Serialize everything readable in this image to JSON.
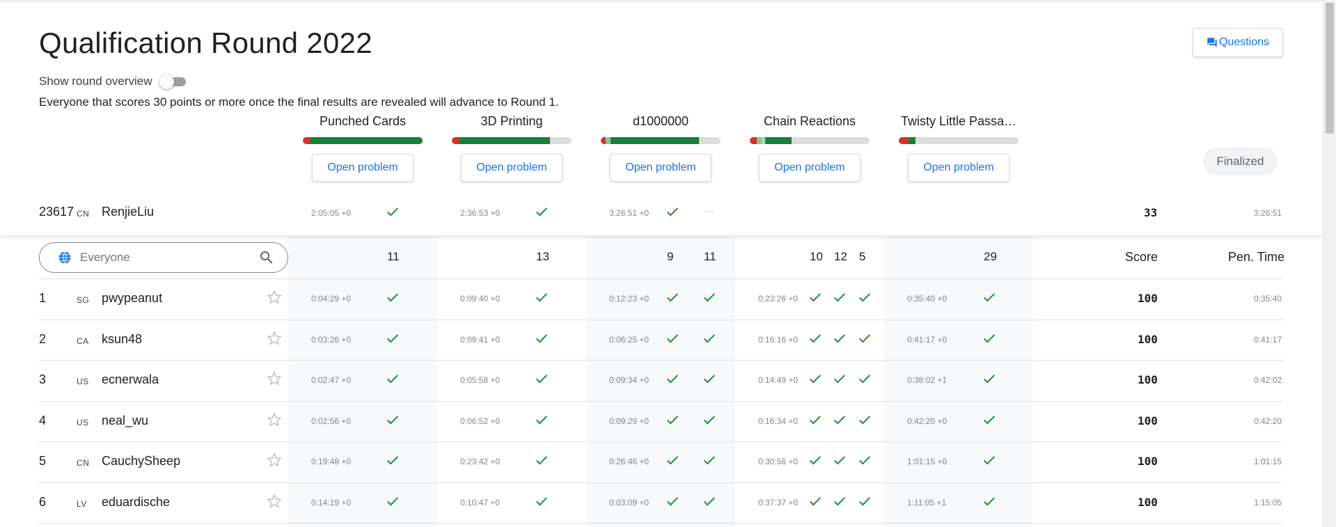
{
  "page": {
    "title": "Qualification Round 2022",
    "questions_label": "Questions",
    "overview_label": "Show round overview",
    "notice": "Everyone that scores 30 points or more once the final results are revealed will advance to Round 1.",
    "finalized_label": "Finalized",
    "open_problem_label": "Open problem"
  },
  "colors": {
    "accent": "#1a73e8",
    "check_green": "#1e8e3e",
    "bar_dark_green": "#188038",
    "bar_light_green": "#81c995",
    "bar_red": "#d93025",
    "bar_empty": "#dadce0"
  },
  "problems": [
    {
      "name": "Punched Cards",
      "fractions": [
        {
          "color": "#d93025",
          "pct": 6
        },
        {
          "color": "#188038",
          "pct": 94
        }
      ]
    },
    {
      "name": "3D Printing",
      "fractions": [
        {
          "color": "#d93025",
          "pct": 6
        },
        {
          "color": "#188038",
          "pct": 76
        }
      ]
    },
    {
      "name": "d1000000",
      "fractions": [
        {
          "color": "#d93025",
          "pct": 4
        },
        {
          "color": "#81c995",
          "pct": 4
        },
        {
          "color": "#188038",
          "pct": 74
        }
      ]
    },
    {
      "name": "Chain Reactions",
      "fractions": [
        {
          "color": "#d93025",
          "pct": 6
        },
        {
          "color": "#81c995",
          "pct": 4
        },
        {
          "color": "#a8dab5",
          "pct": 3
        },
        {
          "color": "#188038",
          "pct": 22
        }
      ]
    },
    {
      "name": "Twisty Little Passa…",
      "fractions": [
        {
          "color": "#d93025",
          "pct": 8
        },
        {
          "color": "#188038",
          "pct": 6
        }
      ]
    }
  ],
  "pinned": {
    "rank": "23617",
    "country": "CN",
    "name": "RenjieLiu",
    "times": [
      "2:05:05 +0",
      "2:36:53 +0",
      "3:26:51 +0"
    ],
    "dash": "—",
    "score": "33",
    "penalty": "3:26:51"
  },
  "header": {
    "search_placeholder": "Everyone",
    "points": [
      "11",
      "13",
      "9",
      "11",
      "10",
      "12",
      "5",
      "29"
    ],
    "score_label": "Score",
    "pen_label": "Pen. Time"
  },
  "rows": [
    {
      "rank": "1",
      "country": "SG",
      "name": "pwypeanut",
      "times": [
        "0:04:29 +0",
        "0:09:40 +0",
        "0:12:23 +0",
        "0:23:26 +0",
        "0:35:40 +0"
      ],
      "score": "100",
      "penalty": "0:35:40"
    },
    {
      "rank": "2",
      "country": "CA",
      "name": "ksun48",
      "times": [
        "0:03:26 +0",
        "0:09:41 +0",
        "0:06:25 +0",
        "0:16:16 +0",
        "0:41:17 +0"
      ],
      "score": "100",
      "penalty": "0:41:17"
    },
    {
      "rank": "3",
      "country": "US",
      "name": "ecnerwala",
      "times": [
        "0:02:47 +0",
        "0:05:58 +0",
        "0:09:34 +0",
        "0:14:49 +0",
        "0:38:02 +1"
      ],
      "score": "100",
      "penalty": "0:42:02"
    },
    {
      "rank": "4",
      "country": "US",
      "name": "neal_wu",
      "times": [
        "0:02:56 +0",
        "0:06:52 +0",
        "0:09:29 +0",
        "0:16:34 +0",
        "0:42:20 +0"
      ],
      "score": "100",
      "penalty": "0:42:20"
    },
    {
      "rank": "5",
      "country": "CN",
      "name": "CauchySheep",
      "times": [
        "0:19:48 +0",
        "0:23:42 +0",
        "0:26:46 +0",
        "0:30:56 +0",
        "1:01:15 +0"
      ],
      "score": "100",
      "penalty": "1:01:15"
    },
    {
      "rank": "6",
      "country": "LV",
      "name": "eduardische",
      "times": [
        "0:14:19 +0",
        "0:10:47 +0",
        "0:03:09 +0",
        "0:37:37 +0",
        "1:11:05 +1"
      ],
      "score": "100",
      "penalty": "1:15:05"
    }
  ]
}
